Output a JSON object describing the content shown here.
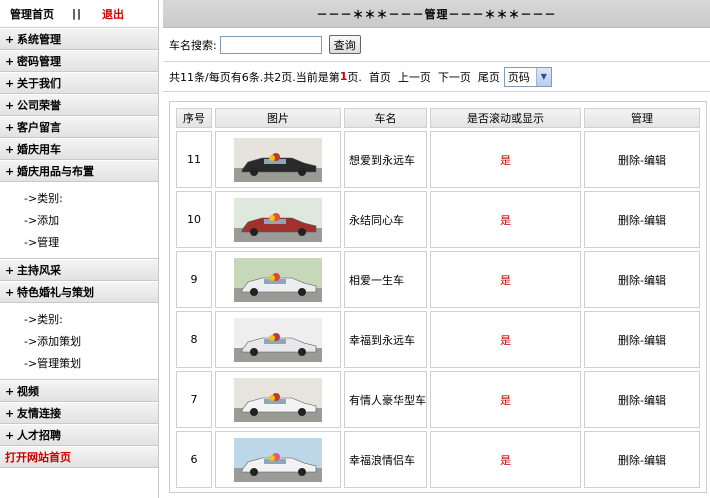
{
  "sidebar": {
    "top": {
      "home": "管理首页",
      "separator": "||",
      "logout": "退出"
    },
    "menu": [
      {
        "label": "系统管理"
      },
      {
        "label": "密码管理"
      },
      {
        "label": "关于我们"
      },
      {
        "label": "公司荣誉"
      },
      {
        "label": "客户留言"
      },
      {
        "label": "婚庆用车"
      },
      {
        "label": "婚庆用品与布置"
      }
    ],
    "sub1": [
      "->类别:",
      "->添加",
      "->管理"
    ],
    "menu2": [
      {
        "label": "主持风采"
      },
      {
        "label": "特色婚礼与策划"
      }
    ],
    "sub2": [
      "->类别:",
      "->添加策划",
      "->管理策划"
    ],
    "menu3": [
      {
        "label": "视频"
      },
      {
        "label": "友情连接"
      },
      {
        "label": "人才招聘"
      }
    ],
    "open_site": "打开网站首页"
  },
  "main": {
    "title": "－－－＊＊＊－－－管理－－－＊＊＊－－－",
    "search": {
      "label": "车名搜索:",
      "value": "",
      "button": "查询"
    },
    "pager": {
      "summary_before": "共11条/每页有6条.共2页.当前是第",
      "current": "1",
      "summary_after": "页.",
      "first": "首页",
      "prev": "上一页",
      "next": "下一页",
      "last": "尾页",
      "select": "页码"
    },
    "columns": [
      "序号",
      "图片",
      "车名",
      "是否滚动或显示",
      "管理"
    ],
    "rows": [
      {
        "id": "11",
        "name": "想爱到永远车",
        "flag": "是",
        "manage": "删除-编辑"
      },
      {
        "id": "10",
        "name": "永结同心车",
        "flag": "是",
        "manage": "删除-编辑"
      },
      {
        "id": "9",
        "name": "相爱一生车",
        "flag": "是",
        "manage": "删除-编辑"
      },
      {
        "id": "8",
        "name": "幸福到永远车",
        "flag": "是",
        "manage": "删除-编辑"
      },
      {
        "id": "7",
        "name": "有情人豪华型车",
        "flag": "是",
        "manage": "删除-编辑"
      },
      {
        "id": "6",
        "name": "幸福浪情侣车",
        "flag": "是",
        "manage": "删除-编辑"
      }
    ]
  },
  "colors": {
    "accent_red": "#cc0000",
    "header_gray": "#d0d0d0"
  }
}
